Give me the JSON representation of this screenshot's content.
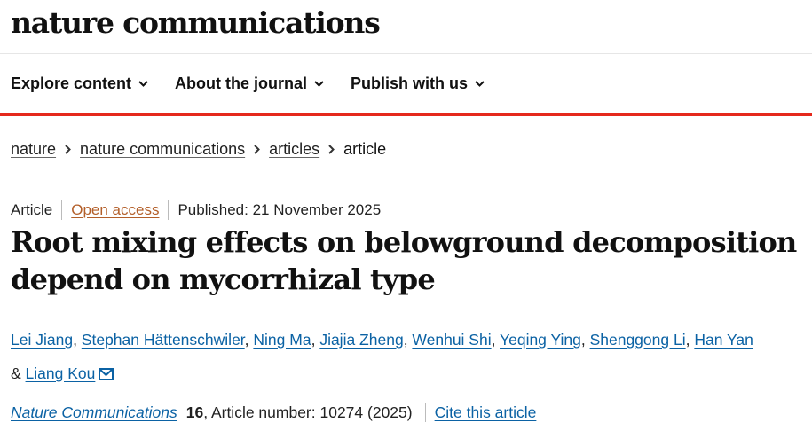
{
  "brand": "nature communications",
  "nav": [
    {
      "label": "Explore content"
    },
    {
      "label": "About the journal"
    },
    {
      "label": "Publish with us"
    }
  ],
  "breadcrumbs": [
    "nature",
    "nature communications",
    "articles",
    "article"
  ],
  "meta": {
    "type": "Article",
    "access": "Open access",
    "published": "Published: 21 November 2025"
  },
  "title": "Root mixing effects on belowground decomposition depend on mycorrhizal type",
  "authors": [
    "Lei Jiang",
    "Stephan Hättenschwiler",
    "Ning Ma",
    "Jiajia Zheng",
    "Wenhui Shi",
    "Yeqing Ying",
    "Shenggong Li",
    "Han Yan",
    "Liang Kou"
  ],
  "authors_sep": ", ",
  "authors_last_sep": "& ",
  "citation": {
    "journal": "Nature Communications",
    "volume": "16",
    "article_number": ", Article number: 10274 (2025)",
    "cite_link": "Cite this article"
  },
  "colors": {
    "accent_red": "#e5291c",
    "link_blue": "#0b62a4",
    "open_access": "#b35f2a"
  },
  "icons": {
    "nav_chevron": "chevron-down-icon",
    "crumb_separator": "chevron-right-icon",
    "email": "envelope-icon"
  }
}
